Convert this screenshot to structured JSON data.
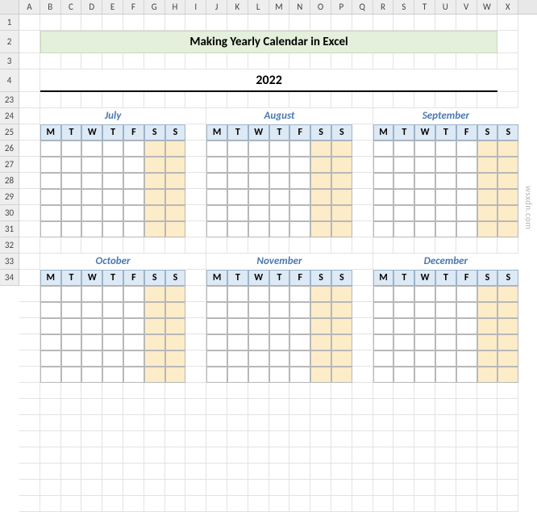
{
  "columns": [
    "A",
    "B",
    "C",
    "D",
    "E",
    "F",
    "G",
    "H",
    "I",
    "J",
    "K",
    "L",
    "M",
    "N",
    "O",
    "P",
    "Q",
    "R",
    "S",
    "T",
    "U",
    "V",
    "W",
    "X"
  ],
  "rows": [
    "1",
    "2",
    "3",
    "4",
    "23",
    "24",
    "25",
    "26",
    "27",
    "28",
    "29",
    "30",
    "31",
    "32",
    "33",
    "34"
  ],
  "title": "Making Yearly Calendar in Excel",
  "year": "2022",
  "day_headers": [
    "M",
    "T",
    "W",
    "T",
    "F",
    "S",
    "S"
  ],
  "months_row1": [
    "July",
    "August",
    "September"
  ],
  "months_row2": [
    "October",
    "November",
    "December"
  ],
  "watermark": "wsxdn.com"
}
